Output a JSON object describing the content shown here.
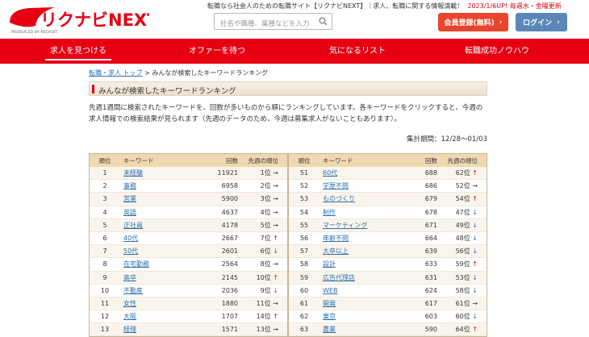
{
  "header": {
    "logo_text": "リクナビNEXT",
    "produced_by": "PRODUCED BY RECRUIT",
    "tagline_main": "転職なら社会人のための転職サイト【リクナビNEXT】｜求人、転職に関する情報満載！",
    "tagline_update": "2023/1/6UP! 毎週水・金曜更新",
    "search_placeholder": "社名や職種、業種などを入力",
    "register_label": "会員登録(無料)",
    "login_label": "ログイン",
    "brand_color": "#e60012"
  },
  "nav": {
    "items": [
      {
        "label": "求人を見つける"
      },
      {
        "label": "オファーを待つ"
      },
      {
        "label": "気になるリスト"
      },
      {
        "label": "転職成功ノウハウ"
      }
    ]
  },
  "breadcrumb": {
    "link": "転職・求人 トップ",
    "sep": ">",
    "current": "みんなが検索したキーワードランキング"
  },
  "page_title": "みんなが検索したキーワードランキング",
  "description": "先週1週間に検索されたキーワードを、回数が多いものから順にランキングしています。各キーワードをクリックすると、今週の求人情報での検索結果が見られます（先週のデータのため、今週は募集求人がないこともあります）。",
  "period": "集計期間：12/28～01/03",
  "columns": {
    "rank": "順位",
    "keyword": "キーワード",
    "count": "回数",
    "prev": "先週の順位"
  },
  "left_rows": [
    {
      "rank": "1",
      "keyword": "未経験",
      "count": "11921",
      "prev": "1位",
      "arrow": "→",
      "dir": "same"
    },
    {
      "rank": "2",
      "keyword": "事務",
      "count": "6958",
      "prev": "2位",
      "arrow": "→",
      "dir": "same"
    },
    {
      "rank": "3",
      "keyword": "営業",
      "count": "5900",
      "prev": "3位",
      "arrow": "→",
      "dir": "same"
    },
    {
      "rank": "4",
      "keyword": "英語",
      "count": "4637",
      "prev": "4位",
      "arrow": "→",
      "dir": "same"
    },
    {
      "rank": "5",
      "keyword": "正社員",
      "count": "4178",
      "prev": "5位",
      "arrow": "→",
      "dir": "same"
    },
    {
      "rank": "6",
      "keyword": "40代",
      "count": "2667",
      "prev": "7位",
      "arrow": "↑",
      "dir": "up"
    },
    {
      "rank": "7",
      "keyword": "50代",
      "count": "2601",
      "prev": "6位",
      "arrow": "↓",
      "dir": "down"
    },
    {
      "rank": "8",
      "keyword": "在宅勤務",
      "count": "2564",
      "prev": "8位",
      "arrow": "→",
      "dir": "same"
    },
    {
      "rank": "9",
      "keyword": "高卒",
      "count": "2145",
      "prev": "10位",
      "arrow": "↑",
      "dir": "up"
    },
    {
      "rank": "10",
      "keyword": "不動産",
      "count": "2036",
      "prev": "9位",
      "arrow": "↓",
      "dir": "down"
    },
    {
      "rank": "11",
      "keyword": "女性",
      "count": "1880",
      "prev": "11位",
      "arrow": "→",
      "dir": "same"
    },
    {
      "rank": "12",
      "keyword": "大阪",
      "count": "1707",
      "prev": "14位",
      "arrow": "↑",
      "dir": "up"
    },
    {
      "rank": "13",
      "keyword": "経理",
      "count": "1571",
      "prev": "13位",
      "arrow": "→",
      "dir": "same"
    }
  ],
  "right_rows": [
    {
      "rank": "51",
      "keyword": "60代",
      "count": "688",
      "prev": "62位",
      "arrow": "↑",
      "dir": "up"
    },
    {
      "rank": "52",
      "keyword": "学歴不問",
      "count": "686",
      "prev": "52位",
      "arrow": "→",
      "dir": "same"
    },
    {
      "rank": "53",
      "keyword": "ものづくり",
      "count": "679",
      "prev": "54位",
      "arrow": "↑",
      "dir": "up"
    },
    {
      "rank": "54",
      "keyword": "制作",
      "count": "678",
      "prev": "47位",
      "arrow": "↓",
      "dir": "down"
    },
    {
      "rank": "55",
      "keyword": "マーケティング",
      "count": "671",
      "prev": "49位",
      "arrow": "↓",
      "dir": "down"
    },
    {
      "rank": "56",
      "keyword": "年齢不問",
      "count": "664",
      "prev": "48位",
      "arrow": "↓",
      "dir": "down"
    },
    {
      "rank": "57",
      "keyword": "大卒以上",
      "count": "639",
      "prev": "56位",
      "arrow": "↓",
      "dir": "down"
    },
    {
      "rank": "58",
      "keyword": "設計",
      "count": "633",
      "prev": "59位",
      "arrow": "↑",
      "dir": "up"
    },
    {
      "rank": "59",
      "keyword": "広告代理店",
      "count": "631",
      "prev": "53位",
      "arrow": "↓",
      "dir": "down"
    },
    {
      "rank": "60",
      "keyword": "WEB",
      "count": "624",
      "prev": "58位",
      "arrow": "↓",
      "dir": "down"
    },
    {
      "rank": "61",
      "keyword": "開発",
      "count": "617",
      "prev": "61位",
      "arrow": "→",
      "dir": "same"
    },
    {
      "rank": "62",
      "keyword": "東京",
      "count": "603",
      "prev": "60位",
      "arrow": "↓",
      "dir": "down"
    },
    {
      "rank": "63",
      "keyword": "農業",
      "count": "590",
      "prev": "64位",
      "arrow": "↑",
      "dir": "up"
    }
  ]
}
